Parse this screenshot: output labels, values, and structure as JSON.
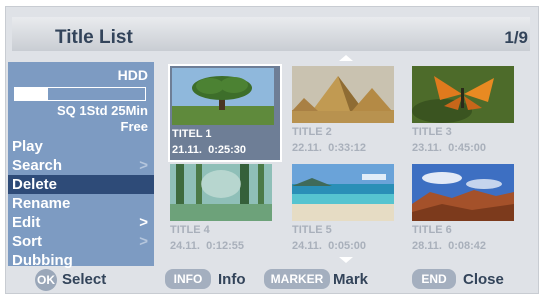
{
  "header": {
    "title": "Title List",
    "page": "1/9"
  },
  "storage": {
    "device": "HDD",
    "info_line1": "SQ  1Std 25Min",
    "info_line2": "Free",
    "used_fraction": 0.25
  },
  "menu": {
    "items": [
      {
        "label": "Play",
        "arrow": "",
        "selected": false
      },
      {
        "label": "Search",
        "arrow": ">",
        "selected": false
      },
      {
        "label": "Delete",
        "arrow": "",
        "selected": true
      },
      {
        "label": "Rename",
        "arrow": "",
        "selected": false
      },
      {
        "label": "Edit",
        "arrow": ">",
        "selected": false
      },
      {
        "label": "Sort",
        "arrow": ">",
        "selected": false
      },
      {
        "label": "Dubbing",
        "arrow": "",
        "selected": false
      }
    ]
  },
  "titles": [
    {
      "name": "TITEL 1",
      "date": "21.11.",
      "time": "0:25:30",
      "selected": true,
      "thumb": "tree"
    },
    {
      "name": "TITLE 2",
      "date": "22.11.",
      "time": "0:33:12",
      "selected": false,
      "thumb": "pyramids"
    },
    {
      "name": "TITLE 3",
      "date": "23.11.",
      "time": "0:45:00",
      "selected": false,
      "thumb": "butterfly"
    },
    {
      "name": "TITLE 4",
      "date": "24.11.",
      "time": "0:12:55",
      "selected": false,
      "thumb": "forest"
    },
    {
      "name": "TITLE 5",
      "date": "24.11.",
      "time": "0:05:00",
      "selected": false,
      "thumb": "beach"
    },
    {
      "name": "TITLE 6",
      "date": "28.11.",
      "time": "0:08:42",
      "selected": false,
      "thumb": "canyon"
    }
  ],
  "footer": {
    "ok_key": "OK",
    "ok_label": "Select",
    "info_key": "INFO",
    "info_label": "Info",
    "marker_key": "MARKER",
    "marker_label": "Mark",
    "end_key": "END",
    "end_label": "Close"
  },
  "colors": {
    "panel": "#dfe2e7",
    "sidebar": "#7d9bc2",
    "selection": "#2e4b78",
    "text_dark": "#33445a"
  }
}
